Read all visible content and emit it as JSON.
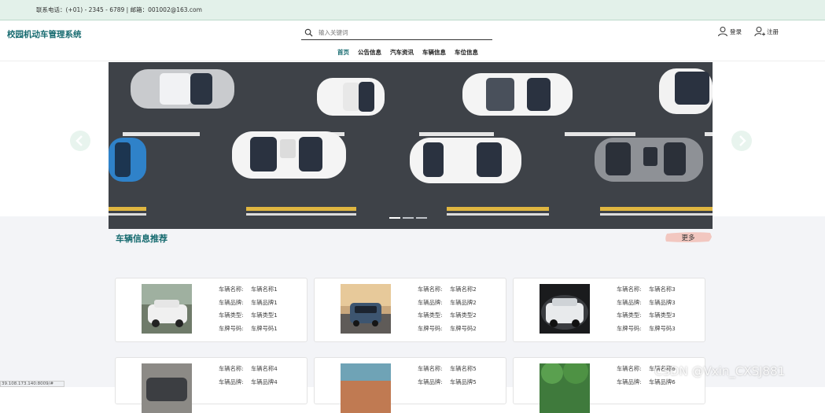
{
  "topbar": {
    "contact": "联系电话：(+01) - 2345 - 6789 | 邮箱：001002@163.com"
  },
  "header": {
    "logo": "校园机动车管理系统",
    "search": {
      "placeholder": "输入关键词",
      "value": ""
    },
    "login": "登录",
    "register": "注册"
  },
  "nav": [
    "首页",
    "公告信息",
    "汽车资讯",
    "车辆信息",
    "车位信息"
  ],
  "section": {
    "title": "车辆信息推荐",
    "more": "更多"
  },
  "cards": [
    {
      "rows": [
        {
          "k": "车辆名称:",
          "v": "车辆名称1"
        },
        {
          "k": "车辆品牌:",
          "v": "车辆品牌1"
        },
        {
          "k": "车辆类型:",
          "v": "车辆类型1"
        },
        {
          "k": "车牌号码:",
          "v": "车牌号码1"
        }
      ]
    },
    {
      "rows": [
        {
          "k": "车辆名称:",
          "v": "车辆名称2"
        },
        {
          "k": "车辆品牌:",
          "v": "车辆品牌2"
        },
        {
          "k": "车辆类型:",
          "v": "车辆类型2"
        },
        {
          "k": "车牌号码:",
          "v": "车牌号码2"
        }
      ]
    },
    {
      "rows": [
        {
          "k": "车辆名称:",
          "v": "车辆名称3"
        },
        {
          "k": "车辆品牌:",
          "v": "车辆品牌3"
        },
        {
          "k": "车辆类型:",
          "v": "车辆类型3"
        },
        {
          "k": "车牌号码:",
          "v": "车牌号码3"
        }
      ]
    },
    {
      "rows": [
        {
          "k": "车辆名称:",
          "v": "车辆名称4"
        },
        {
          "k": "车辆品牌:",
          "v": "车辆品牌4"
        }
      ]
    },
    {
      "rows": [
        {
          "k": "车辆名称:",
          "v": "车辆名称5"
        },
        {
          "k": "车辆品牌:",
          "v": "车辆品牌5"
        }
      ]
    },
    {
      "rows": [
        {
          "k": "车辆名称:",
          "v": "车辆名称6"
        },
        {
          "k": "车辆品牌:",
          "v": "车辆品牌6"
        }
      ]
    }
  ],
  "status_url": "39.108.173.140:8009/#",
  "watermark": "CSDN @Vxin_CXSJ881",
  "colors": {
    "accent": "#156a6f",
    "topbar_bg": "#e3f1ea",
    "more_brush": "#f2c7c0"
  }
}
